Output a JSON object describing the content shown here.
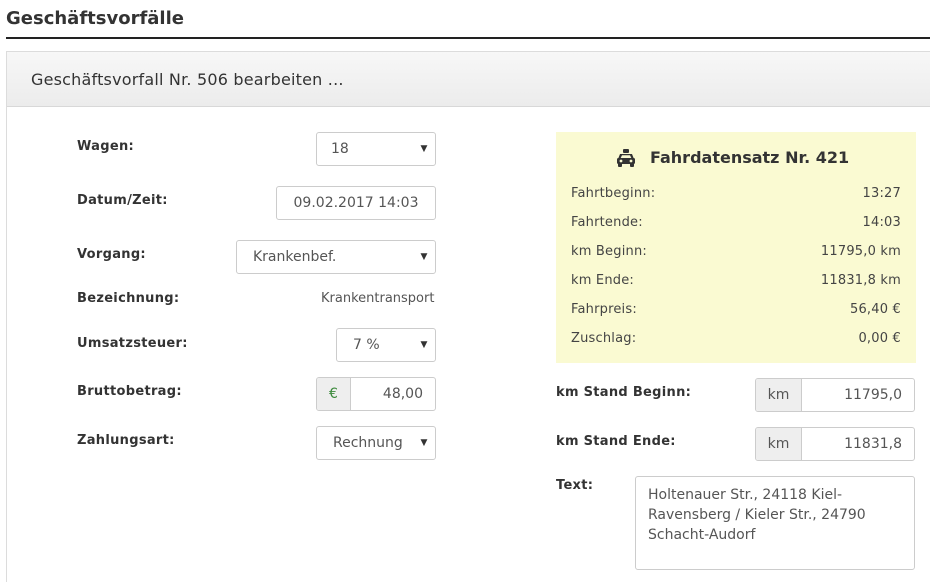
{
  "page": {
    "title": "Geschäftsvorfälle"
  },
  "panel": {
    "title": "Geschäftsvorfall Nr. 506 bearbeiten ..."
  },
  "form": {
    "wagen": {
      "label": "Wagen:",
      "value": "18"
    },
    "datum": {
      "label": "Datum/Zeit:",
      "value": "09.02.2017 14:03"
    },
    "vorgang": {
      "label": "Vorgang:",
      "value": "Krankenbef."
    },
    "bezeichnung": {
      "label": "Bezeichnung:",
      "value": "Krankentransport"
    },
    "umsatzsteuer": {
      "label": "Umsatzsteuer:",
      "value": "7 %"
    },
    "brutto": {
      "label": "Bruttobetrag:",
      "addon": "€",
      "value": "48,00"
    },
    "zahlungsart": {
      "label": "Zahlungsart:",
      "value": "Rechnung"
    },
    "km_beginn": {
      "label": "km Stand Beginn:",
      "addon": "km",
      "value": "11795,0"
    },
    "km_ende": {
      "label": "km Stand Ende:",
      "addon": "km",
      "value": "11831,8"
    },
    "text": {
      "label": "Text:",
      "value": "Holtenauer Str., 24118 Kiel-\nRavensberg / Kieler Str., 24790\nSchacht-Audorf"
    }
  },
  "ride": {
    "title": "Fahrdatensatz Nr. 421",
    "icon": "taxi-icon",
    "rows": [
      {
        "label": "Fahrtbeginn:",
        "value": "13:27"
      },
      {
        "label": "Fahrtende:",
        "value": "14:03"
      },
      {
        "label": "km Beginn:",
        "value": "11795,0 km"
      },
      {
        "label": "km Ende:",
        "value": "11831,8 km"
      },
      {
        "label": "Fahrpreis:",
        "value": "56,40 €"
      },
      {
        "label": "Zuschlag:",
        "value": "0,00 €"
      }
    ]
  },
  "colors": {
    "ride_box_bg": "#fafad2",
    "euro_green": "#3c8a3c"
  }
}
